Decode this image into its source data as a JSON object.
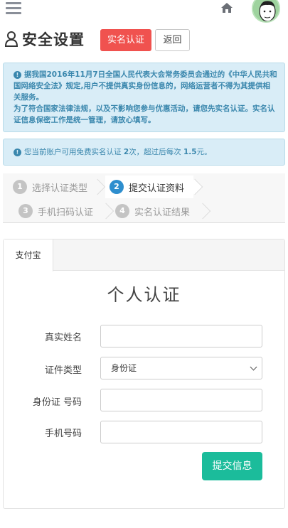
{
  "header": {
    "menu_icon": "hamburger-menu-icon",
    "home_icon": "home-icon",
    "avatar": "user-avatar"
  },
  "title_bar": {
    "icon": "user-outline-icon",
    "title": "安全设置",
    "verify_button": "实名认证",
    "back_button": "返回"
  },
  "notices": {
    "law_notice_line1": "据我国2016年11月7日全国人民代表大会常务委员会通过的《中华人民共和国网络安全法》规定,用户不提供真实身份信息的，网络运营者不得为其提供相关服务。",
    "law_notice_line2": "为了符合国家法律法规，以及不影响您参与优惠活动，请您先实名认证。实名认证信息保密工作是统一管理，请放心填写。",
    "quota_prefix": "您当前账户可用免费实名认证",
    "quota_count": "2",
    "quota_middle": "次，超过后每次",
    "quota_price": "1.5",
    "quota_suffix": "元。"
  },
  "steps": [
    {
      "num": "1",
      "label": "选择认证类型"
    },
    {
      "num": "2",
      "label": "提交认证资料"
    },
    {
      "num": "3",
      "label": "手机扫码认证"
    },
    {
      "num": "4",
      "label": "实名认证结果"
    }
  ],
  "form": {
    "tab_label": "支付宝",
    "title": "个人认证",
    "name_label": "真实姓名",
    "name_value": "",
    "id_type_label": "证件类型",
    "id_type_value": "身份证",
    "id_number_label": "身份证 号码",
    "id_number_value": "",
    "phone_label": "手机号码",
    "phone_value": "",
    "submit_button": "提交信息"
  },
  "colors": {
    "danger": "#f0524f",
    "info_bg": "#d9edf7",
    "info_text": "#3a87ad",
    "step_active": "#2e8ece",
    "success": "#1bbc9b"
  }
}
